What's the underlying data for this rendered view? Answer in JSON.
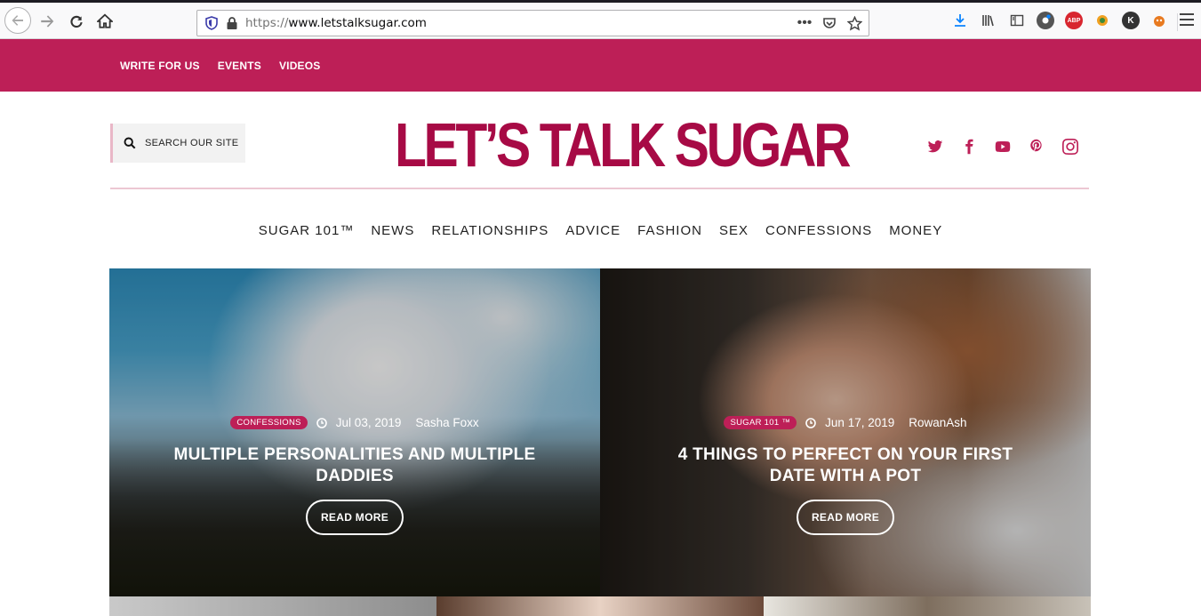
{
  "browser": {
    "url_protocol": "https://",
    "url_host": "www.letstalksugar.com",
    "page_actions_label": "•••"
  },
  "topbar": {
    "links": [
      "WRITE FOR US",
      "EVENTS",
      "VIDEOS"
    ]
  },
  "header": {
    "search_label": "SEARCH OUR SITE",
    "logo_text": "LET’S TALK SUGAR",
    "social": [
      "twitter-icon",
      "facebook-icon",
      "youtube-icon",
      "pinterest-icon",
      "instagram-icon"
    ]
  },
  "nav": {
    "items": [
      "SUGAR 101™",
      "NEWS",
      "RELATIONSHIPS",
      "ADVICE",
      "FASHION",
      "SEX",
      "CONFESSIONS",
      "MONEY"
    ]
  },
  "hero": {
    "cards": [
      {
        "category": "CONFESSIONS",
        "date": "Jul 03, 2019",
        "author": "Sasha Foxx",
        "title": "MULTIPLE PERSONALITIES AND MULTIPLE DADDIES",
        "button": "READ MORE"
      },
      {
        "category": "SUGAR 101 ™",
        "date": "Jun 17, 2019",
        "author": "RowanAsh",
        "title": "4 THINGS TO PERFECT ON YOUR FIRST DATE WITH A POT",
        "button": "READ MORE"
      }
    ]
  },
  "colors": {
    "brand": "#bd1f57",
    "logo": "#a70a45"
  }
}
